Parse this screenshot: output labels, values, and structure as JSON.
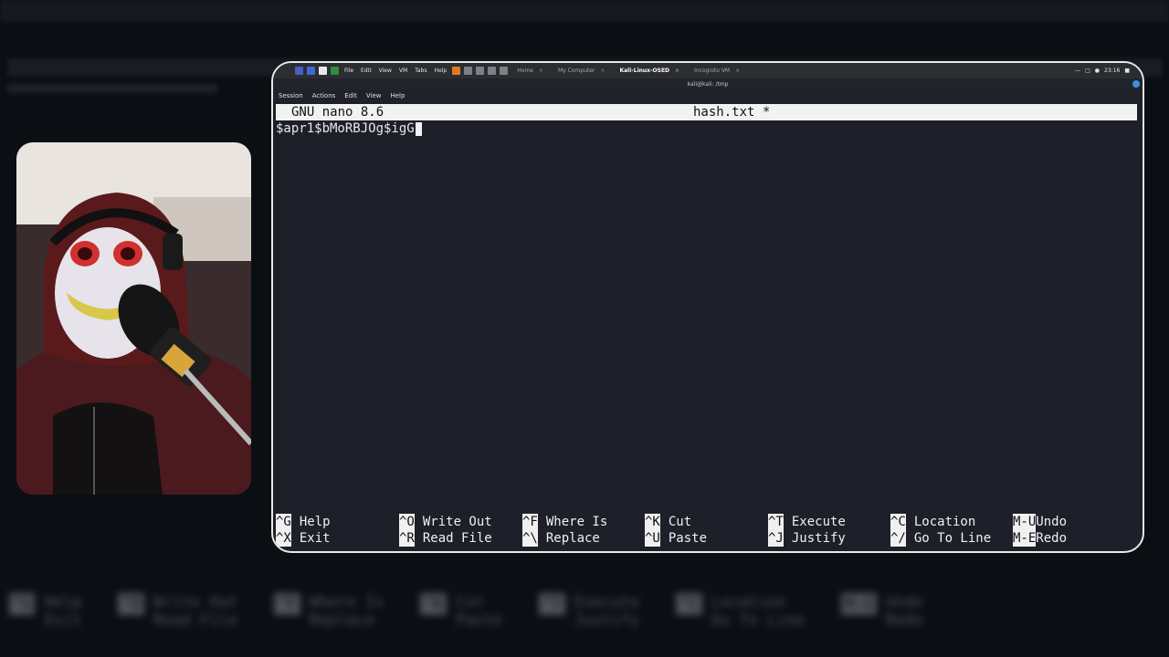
{
  "vm_toolbar": {
    "menus": [
      "File",
      "Edit",
      "View",
      "VM",
      "Tabs",
      "Help"
    ],
    "tabs": [
      {
        "label": "Home",
        "active": false
      },
      {
        "label": "My Computer",
        "active": false
      },
      {
        "label": "Kali-Linux-OSED",
        "active": true
      },
      {
        "label": "Incognito VM",
        "active": false
      }
    ],
    "clock": "23:16"
  },
  "terminal": {
    "title": "kali@kali: /tmp",
    "menus": [
      "Session",
      "Actions",
      "Edit",
      "View",
      "Help"
    ]
  },
  "nano": {
    "version": "GNU nano 8.6",
    "filename": "hash.txt *",
    "content": "$apr1$bMoRBJOg$igG",
    "shortcuts_row1": [
      {
        "key": "^G",
        "label": "Help"
      },
      {
        "key": "^O",
        "label": "Write Out"
      },
      {
        "key": "^F",
        "label": "Where Is"
      },
      {
        "key": "^K",
        "label": "Cut"
      },
      {
        "key": "^T",
        "label": "Execute"
      },
      {
        "key": "^C",
        "label": "Location"
      },
      {
        "key": "M-U",
        "label": "Undo"
      }
    ],
    "shortcuts_row2": [
      {
        "key": "^X",
        "label": "Exit"
      },
      {
        "key": "^R",
        "label": "Read File"
      },
      {
        "key": "^\\",
        "label": "Replace"
      },
      {
        "key": "^U",
        "label": "Paste"
      },
      {
        "key": "^J",
        "label": "Justify"
      },
      {
        "key": "^/",
        "label": "Go To Line"
      },
      {
        "key": "M-E",
        "label": "Redo"
      }
    ]
  },
  "colors": {
    "terminal_bg": "#1d2028",
    "header_bg": "#f2f2f2",
    "accent": "#3d8ee0"
  }
}
